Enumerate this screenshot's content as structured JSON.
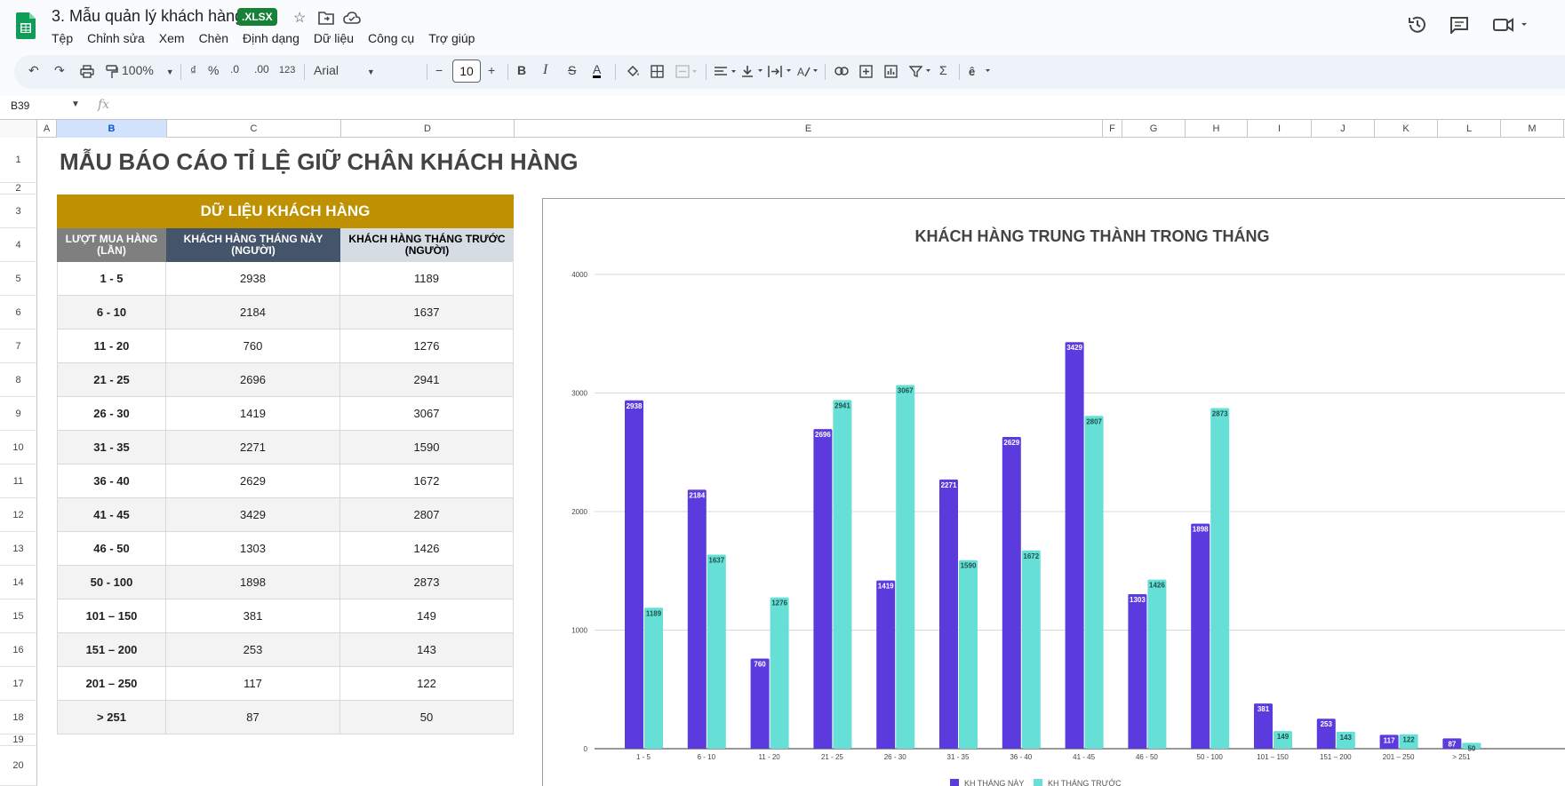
{
  "header": {
    "doc_title": "3. Mẫu quản lý khách hàng",
    "file_badge": ".XLSX",
    "menus": [
      "Tệp",
      "Chỉnh sửa",
      "Xem",
      "Chèn",
      "Định dạng",
      "Dữ liệu",
      "Công cụ",
      "Trợ giúp"
    ],
    "icons": [
      "star-icon",
      "move-to-folder-icon",
      "cloud-status-icon",
      "version-history-icon",
      "comments-icon",
      "meet-icon"
    ]
  },
  "toolbar": {
    "zoom": "100%",
    "currency": "₫",
    "percent": "%",
    "dec_decrease": ".0",
    "dec_increase": ".00",
    "number_format": "123",
    "font": "Arial",
    "font_size": "10",
    "bold": "B",
    "italic": "I",
    "strike": "S",
    "text_color": "A",
    "sum": "Σ"
  },
  "formula_bar": {
    "cell_ref": "B39",
    "fx": "fx"
  },
  "columns": [
    "A",
    "B",
    "C",
    "D",
    "E",
    "F",
    "G",
    "H",
    "I",
    "J",
    "K",
    "L",
    "M"
  ],
  "rows": [
    "1",
    "2",
    "3",
    "4",
    "5",
    "6",
    "7",
    "8",
    "9",
    "10",
    "11",
    "12",
    "13",
    "14",
    "15",
    "16",
    "17",
    "18",
    "19",
    "20"
  ],
  "sheet": {
    "title": "MẪU BÁO CÁO TỈ LỆ GIỮ CHÂN KHÁCH HÀNG",
    "table_title": "DỮ LIỆU KHÁCH HÀNG",
    "col_headers": [
      "LƯỢT MUA HÀNG (LẦN)",
      "KHÁCH HÀNG THÁNG NÀY (NGƯỜI)",
      "KHÁCH HÀNG THÁNG TRƯỚC (NGƯỜI)"
    ],
    "header_colors": {
      "title": "#bf9000",
      "c1": "#7f7f7f",
      "c2": "#44546a",
      "c3": "#d6dce4"
    },
    "data_rows": [
      {
        "range": "1 - 5",
        "this_month": "2938",
        "last_month": "1189"
      },
      {
        "range": "6 - 10",
        "this_month": "2184",
        "last_month": "1637"
      },
      {
        "range": "11 - 20",
        "this_month": "760",
        "last_month": "1276"
      },
      {
        "range": "21 - 25",
        "this_month": "2696",
        "last_month": "2941"
      },
      {
        "range": "26 - 30",
        "this_month": "1419",
        "last_month": "3067"
      },
      {
        "range": "31 - 35",
        "this_month": "2271",
        "last_month": "1590"
      },
      {
        "range": "36 - 40",
        "this_month": "2629",
        "last_month": "1672"
      },
      {
        "range": "41 - 45",
        "this_month": "3429",
        "last_month": "2807"
      },
      {
        "range": "46 - 50",
        "this_month": "1303",
        "last_month": "1426"
      },
      {
        "range": "50 - 100",
        "this_month": "1898",
        "last_month": "2873"
      },
      {
        "range": "101 – 150",
        "this_month": "381",
        "last_month": "149"
      },
      {
        "range": "151 – 200",
        "this_month": "253",
        "last_month": "143"
      },
      {
        "range": "201 – 250",
        "this_month": "117",
        "last_month": "122"
      },
      {
        "range": "> 251",
        "this_month": "87",
        "last_month": "50"
      }
    ]
  },
  "chart_data": {
    "type": "bar",
    "title": "KHÁCH HÀNG TRUNG THÀNH TRONG THÁNG",
    "categories": [
      "1 - 5",
      "6 - 10",
      "11 - 20",
      "21 - 25",
      "26 - 30",
      "31 - 35",
      "36 - 40",
      "41 - 45",
      "46 - 50",
      "50 - 100",
      "101 – 150",
      "151 – 200",
      "201 – 250",
      "> 251"
    ],
    "series": [
      {
        "name": "KH THÁNG NÀY",
        "color": "#5c3bde",
        "values": [
          2938,
          2184,
          760,
          2696,
          1419,
          2271,
          2629,
          3429,
          1303,
          1898,
          381,
          253,
          117,
          87
        ]
      },
      {
        "name": "KH THÁNG TRƯỚC",
        "color": "#66e0d6",
        "values": [
          1189,
          1637,
          1276,
          2941,
          3067,
          1590,
          1672,
          2807,
          1426,
          2873,
          149,
          143,
          122,
          50
        ]
      }
    ],
    "yticks": [
      "0",
      "1000",
      "2000",
      "3000",
      "4000"
    ],
    "ylim": [
      0,
      4000
    ],
    "grid": true,
    "legend": "bottom",
    "data_labels": true
  }
}
